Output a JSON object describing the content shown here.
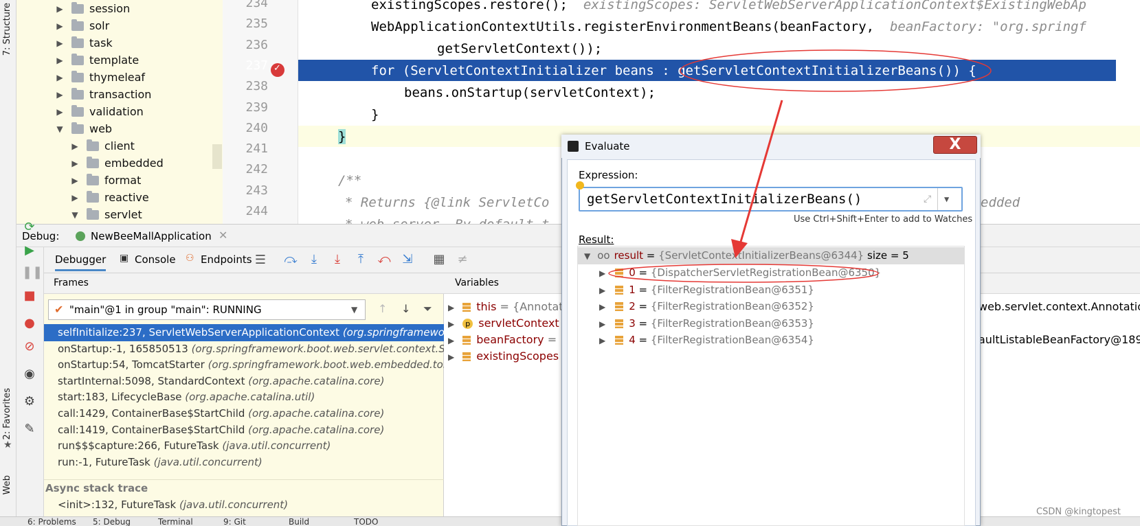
{
  "left_strip": {
    "structure_label": "7: Structure",
    "favorites_label": "2: Favorites",
    "web_label": "Web"
  },
  "project_tree": [
    {
      "label": "session",
      "depth": 0,
      "expanded": false
    },
    {
      "label": "solr",
      "depth": 0,
      "expanded": false
    },
    {
      "label": "task",
      "depth": 0,
      "expanded": false
    },
    {
      "label": "template",
      "depth": 0,
      "expanded": false
    },
    {
      "label": "thymeleaf",
      "depth": 0,
      "expanded": false
    },
    {
      "label": "transaction",
      "depth": 0,
      "expanded": false
    },
    {
      "label": "validation",
      "depth": 0,
      "expanded": false
    },
    {
      "label": "web",
      "depth": 0,
      "expanded": true
    },
    {
      "label": "client",
      "depth": 1,
      "expanded": false
    },
    {
      "label": "embedded",
      "depth": 1,
      "expanded": false
    },
    {
      "label": "format",
      "depth": 1,
      "expanded": false
    },
    {
      "label": "reactive",
      "depth": 1,
      "expanded": false
    },
    {
      "label": "servlet",
      "depth": 1,
      "expanded": true
    }
  ],
  "editor": {
    "line_numbers": [
      "234",
      "235",
      "236",
      "237",
      "238",
      "239",
      "240",
      "241",
      "242",
      "243",
      "244"
    ],
    "l234_code": "existingScopes.restore();",
    "l234_hint": "existingScopes: ServletWebServerApplicationContext$ExistingWebAp",
    "l235_code": "WebApplicationContextUtils.registerEnvironmentBeans(beanFactory,",
    "l235_hint": "beanFactory: \"org.springf",
    "l236_code": "getServletContext());",
    "l237_code": "for (ServletContextInitializer beans : getServletContextInitializerBeans()) {",
    "l238_code": "beans.onStartup(servletContext);",
    "l239_code": "}",
    "l240_code": "}",
    "l242_code": "/**",
    "l243_code": "* Returns {@link ServletCo",
    "l243_tail": "edded",
    "l244_code": "* web server. By default t"
  },
  "debug": {
    "label": "Debug:",
    "config_tab": "NewBeeMallApplication",
    "tabs": [
      "Debugger",
      "Console",
      "Endpoints"
    ],
    "frames_header": "Frames",
    "variables_header": "Variables",
    "thread_select": "\"main\"@1 in group \"main\": RUNNING",
    "frames": [
      {
        "method": "selfInitialize:237, ServletWebServerApplicationContext",
        "pkg": "(org.springframework"
      },
      {
        "method": "onStartup:-1, 165850513",
        "pkg": "(org.springframework.boot.web.servlet.context.Ser"
      },
      {
        "method": "onStartup:54, TomcatStarter",
        "pkg": "(org.springframework.boot.web.embedded.tom"
      },
      {
        "method": "startInternal:5098, StandardContext",
        "pkg": "(org.apache.catalina.core)"
      },
      {
        "method": "start:183, LifecycleBase",
        "pkg": "(org.apache.catalina.util)"
      },
      {
        "method": "call:1429, ContainerBase$StartChild",
        "pkg": "(org.apache.catalina.core)"
      },
      {
        "method": "call:1419, ContainerBase$StartChild",
        "pkg": "(org.apache.catalina.core)"
      },
      {
        "method": "run$$$capture:266, FutureTask",
        "pkg": "(java.util.concurrent)"
      },
      {
        "method": "run:-1, FutureTask",
        "pkg": "(java.util.concurrent)"
      }
    ],
    "async_label": "Async stack trace",
    "async_frame": {
      "method": "<init>:132, FutureTask",
      "pkg": "(java.util.concurrent)"
    },
    "variables": [
      {
        "name": "this",
        "value": "= {Annotati",
        "tail": "web.servlet.context.AnnotationC"
      },
      {
        "name": "servletContext",
        "value": "=",
        "tail": ""
      },
      {
        "name": "beanFactory",
        "value": "= {",
        "tail": "aultListableBeanFactory@18920"
      },
      {
        "name": "existingScopes",
        "value": "",
        "tail": ""
      }
    ]
  },
  "evaluate": {
    "title": "Evaluate",
    "close": "X",
    "expression_label": "Expression:",
    "expression": "getServletContextInitializerBeans()",
    "hint": "Use Ctrl+Shift+Enter to add to Watches",
    "result_label": "Result:",
    "result": {
      "name": "result",
      "value": "{ServletContextInitializerBeans@6344}",
      "extra": "size = 5"
    },
    "items": [
      {
        "index": "0",
        "value": "{DispatcherServletRegistrationBean@6350}"
      },
      {
        "index": "1",
        "value": "{FilterRegistrationBean@6351}"
      },
      {
        "index": "2",
        "value": "{FilterRegistrationBean@6352}"
      },
      {
        "index": "3",
        "value": "{FilterRegistrationBean@6353}"
      },
      {
        "index": "4",
        "value": "{FilterRegistrationBean@6354}"
      }
    ]
  },
  "bottom_tabs": [
    "6: Problems",
    "5: Debug",
    "Terminal",
    "9: Git",
    "Build",
    "TODO"
  ],
  "watermark": "CSDN @kingtopest",
  "colors": {
    "accent": "#2154a8",
    "selection": "#2c6dc6",
    "annotation": "#e53935"
  }
}
